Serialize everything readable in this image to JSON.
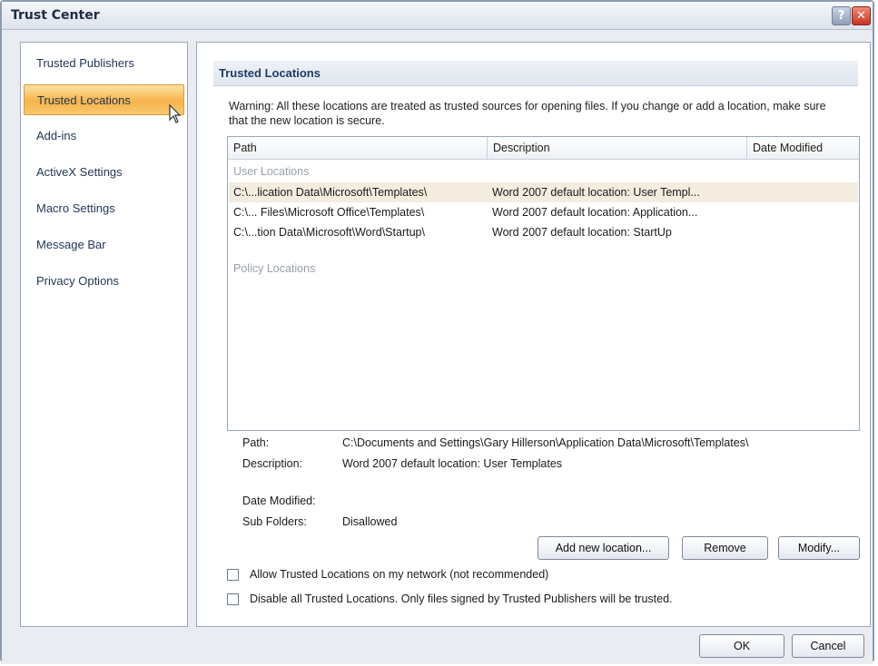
{
  "window": {
    "title": "Trust Center",
    "help_glyph": "?",
    "close_glyph": "✕"
  },
  "nav": {
    "items": [
      {
        "label": "Trusted Publishers"
      },
      {
        "label": "Trusted Locations"
      },
      {
        "label": "Add-ins"
      },
      {
        "label": "ActiveX Settings"
      },
      {
        "label": "Macro Settings"
      },
      {
        "label": "Message Bar"
      },
      {
        "label": "Privacy Options"
      }
    ],
    "selected": "Trusted Locations"
  },
  "panel": {
    "section_title": "Trusted Locations",
    "warning": "Warning: All these locations are treated as trusted sources for opening files.  If you change or add a location, make sure that the new location is secure.",
    "columns": {
      "path": "Path",
      "description": "Description",
      "date_modified": "Date Modified"
    },
    "user_locations_label": "User Locations",
    "user_locations": [
      {
        "path": "C:\\...lication Data\\Microsoft\\Templates\\",
        "description": "Word 2007 default location: User Templ...",
        "date_modified": ""
      },
      {
        "path": "C:\\... Files\\Microsoft Office\\Templates\\",
        "description": "Word 2007 default location: Application...",
        "date_modified": ""
      },
      {
        "path": "C:\\...tion Data\\Microsoft\\Word\\Startup\\",
        "description": "Word 2007 default location: StartUp",
        "date_modified": ""
      }
    ],
    "policy_locations_label": "Policy Locations",
    "details": {
      "path_label": "Path:",
      "path_value": "C:\\Documents and Settings\\Gary Hillerson\\Application Data\\Microsoft\\Templates\\",
      "description_label": "Description:",
      "description_value": "Word 2007 default location: User Templates",
      "date_modified_label": "Date Modified:",
      "date_modified_value": "",
      "sub_folders_label": "Sub Folders:",
      "sub_folders_value": "Disallowed"
    },
    "buttons": {
      "add_new_location": "Add new location...",
      "remove": "Remove",
      "modify": "Modify..."
    },
    "checkboxes": {
      "allow_network": "Allow Trusted Locations on my network (not recommended)",
      "allow_network_checked": false,
      "disable_all": "Disable all Trusted Locations. Only files signed by Trusted Publishers will be trusted.",
      "disable_all_checked": false
    }
  },
  "footer": {
    "ok": "OK",
    "cancel": "Cancel"
  },
  "colors": {
    "nav_selected": "#f6b34a",
    "selected_row": "#f3ecdf",
    "section_header_text": "#1e3b66"
  }
}
